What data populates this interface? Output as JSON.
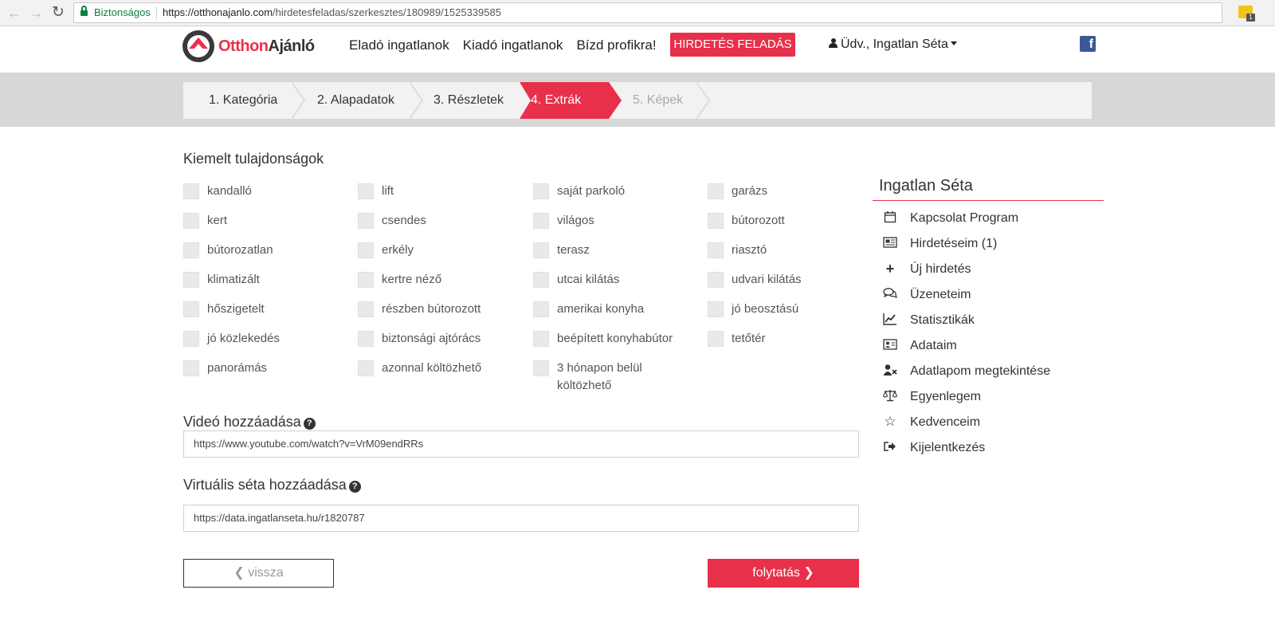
{
  "browser": {
    "secure_label": "Biztonságos",
    "url_host": "https://otthonajanlo.com",
    "url_path": "/hirdetesfeladas/szerkesztes/180989/1525339585",
    "extension_badge": "1"
  },
  "header": {
    "logo_part1": "Otthon",
    "logo_part2": "Ajánló",
    "nav": [
      "Eladó ingatlanok",
      "Kiadó ingatlanok",
      "Bízd profikra!"
    ],
    "cta": "HIRDETÉS FELADÁS",
    "user": "Üdv., Ingatlan Séta"
  },
  "steps": [
    {
      "label": "1. Kategória",
      "state": "done"
    },
    {
      "label": "2. Alapadatok",
      "state": "done"
    },
    {
      "label": "3. Részletek",
      "state": "done"
    },
    {
      "label": "4. Extrák",
      "state": "active"
    },
    {
      "label": "5. Képek",
      "state": "pending"
    }
  ],
  "features": {
    "title": "Kiemelt tulajdonságok",
    "columns": [
      [
        "kandalló",
        "kert",
        "bútorozatlan",
        "klimatizált",
        "hőszigetelt",
        "jó közlekedés",
        "panorámás"
      ],
      [
        "lift",
        "csendes",
        "erkély",
        "kertre néző",
        "részben bútorozott",
        "biztonsági ajtórács",
        "azonnal költözhető"
      ],
      [
        "saját parkoló",
        "világos",
        "terasz",
        "utcai kilátás",
        "amerikai konyha",
        "beépített konyhabútor",
        "3 hónapon belül költözhető"
      ],
      [
        "garázs",
        "bútorozott",
        "riasztó",
        "udvari kilátás",
        "jó beosztású",
        "tetőtér"
      ]
    ]
  },
  "video": {
    "title": "Videó hozzáadása",
    "value": "https://www.youtube.com/watch?v=VrM09endRRs"
  },
  "virtual": {
    "title": "Virtuális séta hozzáadása",
    "value": "https://data.ingatlanseta.hu/r1820787"
  },
  "buttons": {
    "back": "vissza",
    "next": "folytatás"
  },
  "sidebar": {
    "title": "Ingatlan Séta",
    "items": [
      {
        "label": "Kapcsolat Program",
        "icon": "calendar-icon"
      },
      {
        "label": "Hirdetéseim (1)",
        "icon": "newspaper-icon"
      },
      {
        "label": "Új hirdetés",
        "icon": "plus-icon"
      },
      {
        "label": "Üzeneteim",
        "icon": "comments-icon"
      },
      {
        "label": "Statisztikák",
        "icon": "line-chart-icon"
      },
      {
        "label": "Adataim",
        "icon": "id-card-icon"
      },
      {
        "label": "Adatlapom megtekintése",
        "icon": "user-times-icon"
      },
      {
        "label": "Egyenlegem",
        "icon": "balance-scale-icon"
      },
      {
        "label": "Kedvenceim",
        "icon": "star-icon"
      },
      {
        "label": "Kijelentkezés",
        "icon": "sign-out-icon"
      }
    ]
  }
}
